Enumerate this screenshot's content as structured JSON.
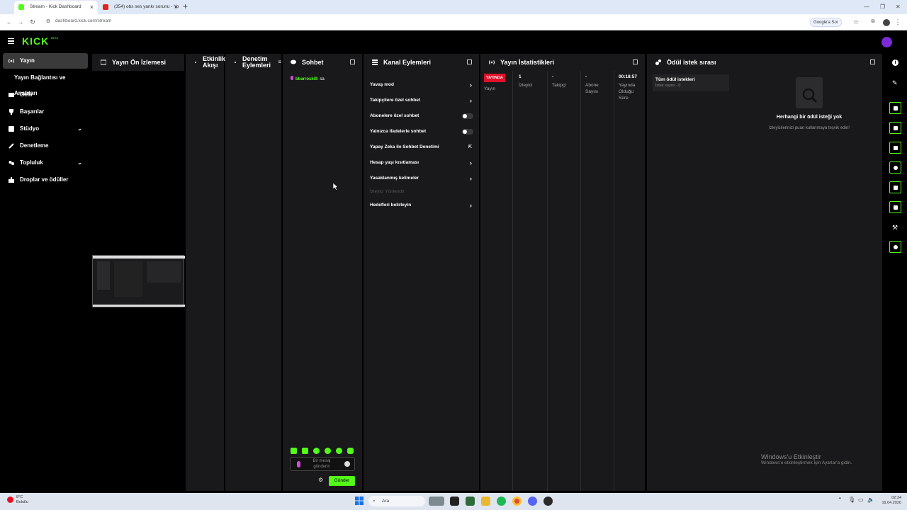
{
  "browser": {
    "tabs": [
      {
        "title": "Stream - Kick Dashboard",
        "active": true,
        "favicon_color": "#53fc18"
      },
      {
        "title": "(354) obs ses yankı sorunu - Yo",
        "active": false,
        "favicon_color": "#e62117"
      }
    ],
    "new_tab": "+",
    "url": "dashboard.kick.com/stream",
    "google_sor": "Google'a Sor"
  },
  "app": {
    "logo": "KICK",
    "logo_beta": "BETA",
    "accent_color": "#53fc18"
  },
  "sidebar": {
    "items": [
      {
        "label": "Yayın",
        "active": true,
        "icon": "stream-icon"
      },
      {
        "label": "Yayın Bağlantısı ve Anahtarı",
        "sub": true
      },
      {
        "label": "Gelir",
        "icon": "revenue-icon"
      },
      {
        "label": "Başarılar",
        "icon": "trophy-icon"
      },
      {
        "label": "Stüdyo",
        "icon": "studio-icon",
        "expandable": true
      },
      {
        "label": "Denetleme",
        "icon": "wrench-icon"
      },
      {
        "label": "Topluluk",
        "icon": "community-icon",
        "expandable": true
      },
      {
        "label": "Droplar ve ödüller",
        "icon": "gift-icon"
      }
    ]
  },
  "panels": {
    "preview": {
      "title": "Yayın Ön İzlemesi"
    },
    "activity": {
      "title": "Etkinlik Akışı"
    },
    "moderation": {
      "title": "Denetim Eylemleri"
    },
    "chat": {
      "title": "Sohbet",
      "message_user": "bbarroskill:",
      "message_text": "sa",
      "input_placeholder": "Bir mesaj gönderin",
      "send_label": "Gönder"
    },
    "channel_actions": {
      "title": "Kanal Eylemleri",
      "items": [
        {
          "label": "Yavaş mod",
          "control": "arrow"
        },
        {
          "label": "Takipçilere özel sohbet",
          "control": "arrow"
        },
        {
          "label": "Abonelere özel sohbet",
          "control": "toggle"
        },
        {
          "label": "Yalnızca ifadelerle sohbet",
          "control": "toggle"
        },
        {
          "label": "Yapay Zeka ile Sohbet Denetimi",
          "control": "external"
        },
        {
          "label": "Hesap yaşı kısıtlaması",
          "control": "arrow"
        },
        {
          "label": "Yasaklanmış kelimeler",
          "control": "arrow"
        },
        {
          "label": "İzleyici Yönlendir",
          "control": "disabled"
        },
        {
          "label": "Hedefleri belirleyin",
          "control": "arrow"
        }
      ]
    },
    "stats": {
      "title": "Yayın İstatistikleri",
      "live_badge": "YAYINDA",
      "live_label": "Yayın",
      "viewers_value": "1",
      "viewers_label": "İzleyici",
      "followers_value": "-",
      "followers_label": "Takipçi",
      "subs_value": "-",
      "subs_label": "Abone Sayısı",
      "uptime_value": "00:18:57",
      "uptime_label": "Yayında Olduğu Süre"
    },
    "rewards": {
      "title": "Ödül istek sırası",
      "filter_title": "Tüm ödül istekleri",
      "filter_sub": "İstek sayısı - 0",
      "empty_title": "Herhangi bir ödül isteği yok",
      "empty_sub": "İzleyicilerinizi puan kullanmaya teşvik edin!"
    }
  },
  "windows": {
    "activate_title": "Windows'u Etkinleştir",
    "activate_sub": "Windows'u etkinleştirmek için Ayarlar'a gidin.",
    "weather_temp": "8°C",
    "weather_desc": "Bulutlu",
    "search": "Ara",
    "time": "02:34",
    "date": "19.04.2026"
  }
}
